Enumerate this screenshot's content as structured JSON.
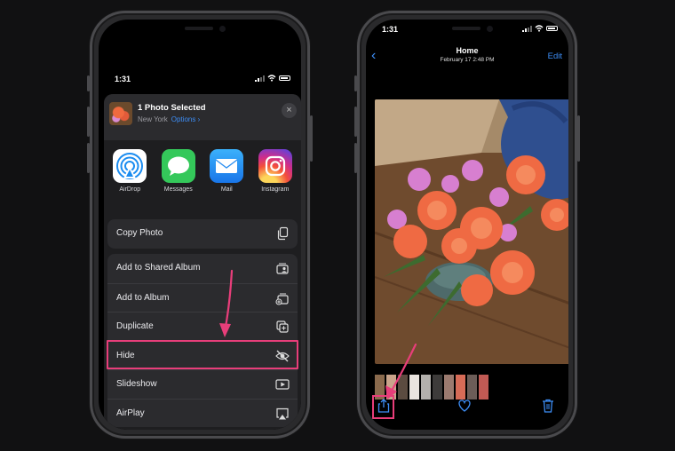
{
  "left_phone": {
    "status_time": "1:31",
    "share_sheet": {
      "title": "1 Photo Selected",
      "location": "New York",
      "options_label": "Options",
      "options_chevron": "›",
      "close_glyph": "×",
      "apps": [
        {
          "label": "AirDrop",
          "icon": "airdrop-icon"
        },
        {
          "label": "Messages",
          "icon": "messages-icon"
        },
        {
          "label": "Mail",
          "icon": "mail-icon"
        },
        {
          "label": "Instagram",
          "icon": "instagram-icon"
        }
      ],
      "actions_primary": [
        {
          "label": "Copy Photo",
          "icon": "copy-icon"
        }
      ],
      "actions_secondary": [
        {
          "label": "Add to Shared Album",
          "icon": "shared-album-icon"
        },
        {
          "label": "Add to Album",
          "icon": "add-album-icon"
        },
        {
          "label": "Duplicate",
          "icon": "duplicate-icon"
        },
        {
          "label": "Hide",
          "icon": "eye-slash-icon",
          "highlighted": true
        },
        {
          "label": "Slideshow",
          "icon": "play-icon"
        },
        {
          "label": "AirPlay",
          "icon": "airplay-icon"
        }
      ]
    }
  },
  "right_phone": {
    "status_time": "1:31",
    "nav": {
      "back_glyph": "‹",
      "title": "Home",
      "subtitle": "February 17  2:48 PM",
      "edit_label": "Edit"
    },
    "toolbar": {
      "share_icon": "share-icon",
      "favorite_icon": "heart-icon",
      "delete_icon": "trash-icon",
      "share_highlighted": true
    }
  },
  "colors": {
    "accent": "#3d8ef7",
    "highlight": "#e83e7a",
    "background": "#111112",
    "sheet": "#1e1e20",
    "row": "#2b2b2e"
  }
}
